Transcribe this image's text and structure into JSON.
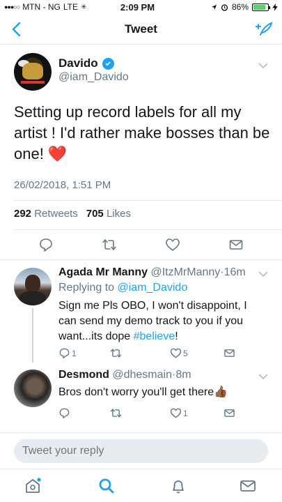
{
  "status_bar": {
    "carrier": "MTN - NG",
    "network": "LTE",
    "time": "2:09 PM",
    "battery": "86%",
    "battery_level": 0.86
  },
  "nav": {
    "title": "Tweet"
  },
  "tweet": {
    "author_name": "Davido",
    "author_handle": "@iam_Davido",
    "text": "Setting up record labels  for all my artist ! I'd rather make bosses than be one! ❤️",
    "timestamp": "26/02/2018, 1:51 PM",
    "retweets_count": "292",
    "retweets_label": "Retweets",
    "likes_count": "705",
    "likes_label": "Likes"
  },
  "replies": [
    {
      "name": "Agada Mr Manny",
      "handle": "@ItzMrManny",
      "dot": "·",
      "time": "16m",
      "replying_prefix": "Replying to",
      "replying_to": "@iam_Davido",
      "text_before": "Sign me Pls OBO, I won't disappoint, I can send my demo track to you if you want...its dope ",
      "hashtag": "#believe",
      "text_after": "!",
      "reply_count": "1",
      "retweet_count": "",
      "like_count": "5"
    },
    {
      "name": "Desmond",
      "handle": "@dhesmain",
      "dot": "·",
      "time": "8m",
      "text": "Bros don't worry you'll get there👍🏾",
      "reply_count": "",
      "retweet_count": "",
      "like_count": "1"
    }
  ],
  "reply_box": {
    "placeholder": "Tweet your reply"
  },
  "colors": {
    "accent": "#1da1f2",
    "text": "#14171a",
    "muted": "#657786",
    "heart": "#e0245e"
  },
  "icons": {
    "back": "chevron-left-icon",
    "compose": "compose-feather-icon",
    "verified": "verified-badge-icon",
    "reply": "reply-bubble-icon",
    "retweet": "retweet-icon",
    "like": "heart-icon",
    "share": "envelope-icon",
    "tabs": [
      "home-icon",
      "search-icon",
      "notifications-bell-icon",
      "messages-envelope-icon"
    ]
  }
}
